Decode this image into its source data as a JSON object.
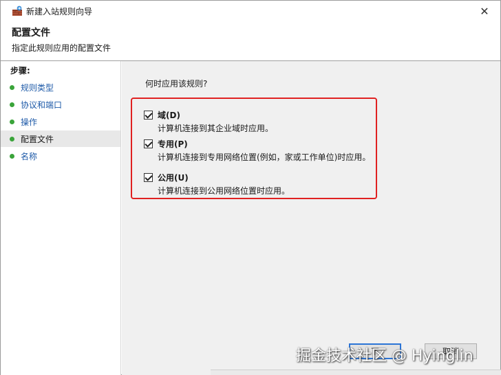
{
  "window": {
    "title": "新建入站规则向导",
    "close_glyph": "✕"
  },
  "header": {
    "title": "配置文件",
    "subtitle": "指定此规则应用的配置文件"
  },
  "steps": {
    "label": "步骤:",
    "items": [
      {
        "label": "规则类型"
      },
      {
        "label": "协议和端口"
      },
      {
        "label": "操作"
      },
      {
        "label": "配置文件"
      },
      {
        "label": "名称"
      }
    ]
  },
  "content": {
    "question": "何时应用该规则?",
    "options": [
      {
        "label": "域(D)",
        "description": "计算机连接到其企业域时应用。",
        "checked": true
      },
      {
        "label": "专用(P)",
        "description": "计算机连接到专用网络位置(例如，家或工作单位)时应用。",
        "checked": true
      },
      {
        "label": "公用(U)",
        "description": "计算机连接到公用网络位置时应用。",
        "checked": true
      }
    ]
  },
  "buttons": {
    "next_fragment": "下",
    "cancel_fragment": "取消"
  },
  "watermark": "掘金技术社区 @ Hyinglin",
  "colors": {
    "accent": "#2b74d6",
    "highlight": "#e02020",
    "step_dot": "#3aa43a",
    "step_link": "#1e5aa8"
  }
}
